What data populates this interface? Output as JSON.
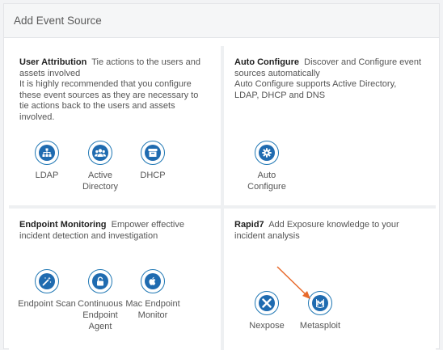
{
  "panel": {
    "title": "Add Event Source"
  },
  "cards": {
    "user_attribution": {
      "title": "User Attribution",
      "desc_1": "Tie actions to the users and assets involved",
      "desc_2": "It is highly recommended that you configure these event sources as they are necessary to tie actions back to the users and assets involved.",
      "sources": [
        {
          "label": "LDAP",
          "icon": "sitemap-icon"
        },
        {
          "label": "Active Directory",
          "icon": "users-icon"
        },
        {
          "label": "DHCP",
          "icon": "archive-box-icon"
        }
      ]
    },
    "auto_configure": {
      "title": "Auto Configure",
      "desc_1": "Discover and Configure event sources automatically",
      "desc_2": "Auto Configure supports Active Directory, LDAP, DHCP and DNS",
      "sources": [
        {
          "label": "Auto Configure",
          "icon": "gear-icon"
        }
      ]
    },
    "endpoint_monitoring": {
      "title": "Endpoint Monitoring",
      "desc_1": "Empower effective incident detection and investigation",
      "sources": [
        {
          "label": "Endpoint Scan",
          "icon": "magic-wand-icon"
        },
        {
          "label": "Continuous Endpoint Agent",
          "icon": "unlock-icon"
        },
        {
          "label": "Mac Endpoint Monitor",
          "icon": "apple-icon"
        }
      ]
    },
    "rapid7": {
      "title": "Rapid7",
      "desc_1": "Add Exposure knowledge to your incident analysis",
      "sources": [
        {
          "label": "Nexpose",
          "icon": "nexpose-icon"
        },
        {
          "label": "Metasploit",
          "icon": "metasploit-icon"
        }
      ]
    }
  },
  "colors": {
    "accent": "#1f6bb0",
    "arrow": "#e8692a"
  }
}
